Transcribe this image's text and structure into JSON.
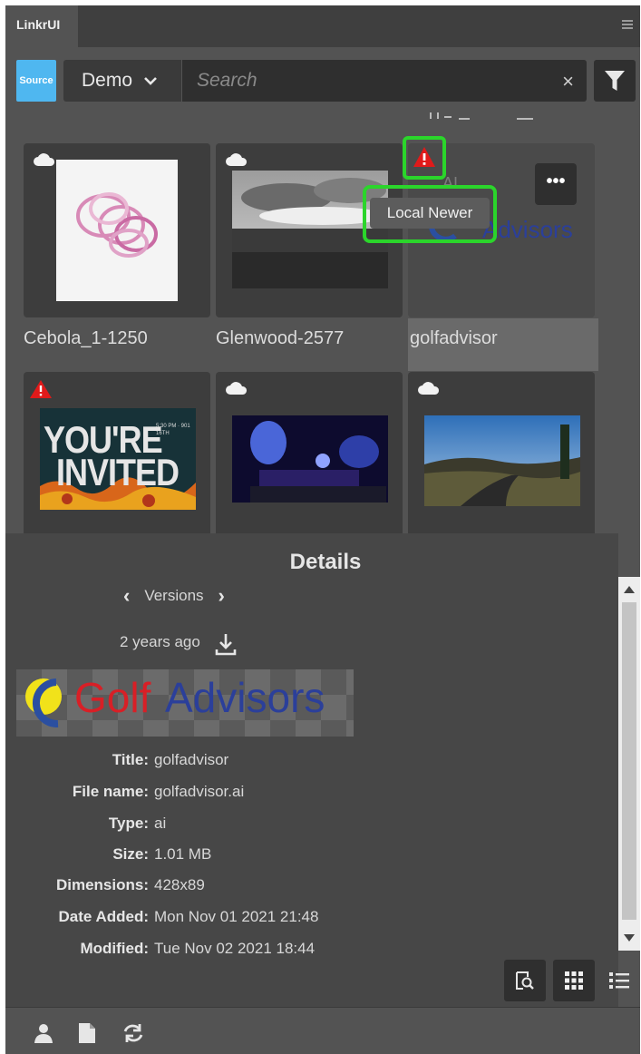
{
  "panel": {
    "tab_title": "LinkrUI"
  },
  "toolbar": {
    "source_label": "Source",
    "project_select": "Demo",
    "search_placeholder": "Search",
    "clear_symbol": "×"
  },
  "tooltip": {
    "text": "Local Newer"
  },
  "assets": [
    {
      "name": "Cebola_1-1250",
      "status_icon": "cloud-icon"
    },
    {
      "name": "Glenwood-2577",
      "status_icon": "cloud-icon"
    },
    {
      "name": "golfadvisor",
      "status_icon": "warning-icon",
      "selected": true,
      "more_label": "•••"
    },
    {
      "name": "",
      "status_icon": "warning-icon",
      "thumb_text_1": "YOU'RE",
      "thumb_text_2": "INVITED",
      "thumb_small": "5:30 PM · 901 16TH"
    },
    {
      "name": "",
      "status_icon": "cloud-icon"
    },
    {
      "name": "",
      "status_icon": "cloud-icon"
    }
  ],
  "thumb_logo": {
    "faint_letters": "AI",
    "text": "Advisors"
  },
  "details": {
    "title": "Details",
    "versions_label": "Versions",
    "age": "2 years ago",
    "logo_golf": "Golf",
    "logo_advisors": "Advisors",
    "fields": [
      {
        "key": "Title:",
        "value": "golfadvisor"
      },
      {
        "key": "File name:",
        "value": "golfadvisor.ai"
      },
      {
        "key": "Type:",
        "value": "ai"
      },
      {
        "key": "Size:",
        "value": "1.01 MB"
      },
      {
        "key": "Dimensions:",
        "value": "428x89"
      },
      {
        "key": "Date Added:",
        "value": "Mon Nov 01 2021 21:48"
      },
      {
        "key": "Modified:",
        "value": "Tue Nov 02 2021 18:44"
      }
    ]
  },
  "colors": {
    "accent": "#4fb7f0",
    "highlight": "#2bd52b",
    "warning": "#e01a1a",
    "panel": "#535353"
  }
}
